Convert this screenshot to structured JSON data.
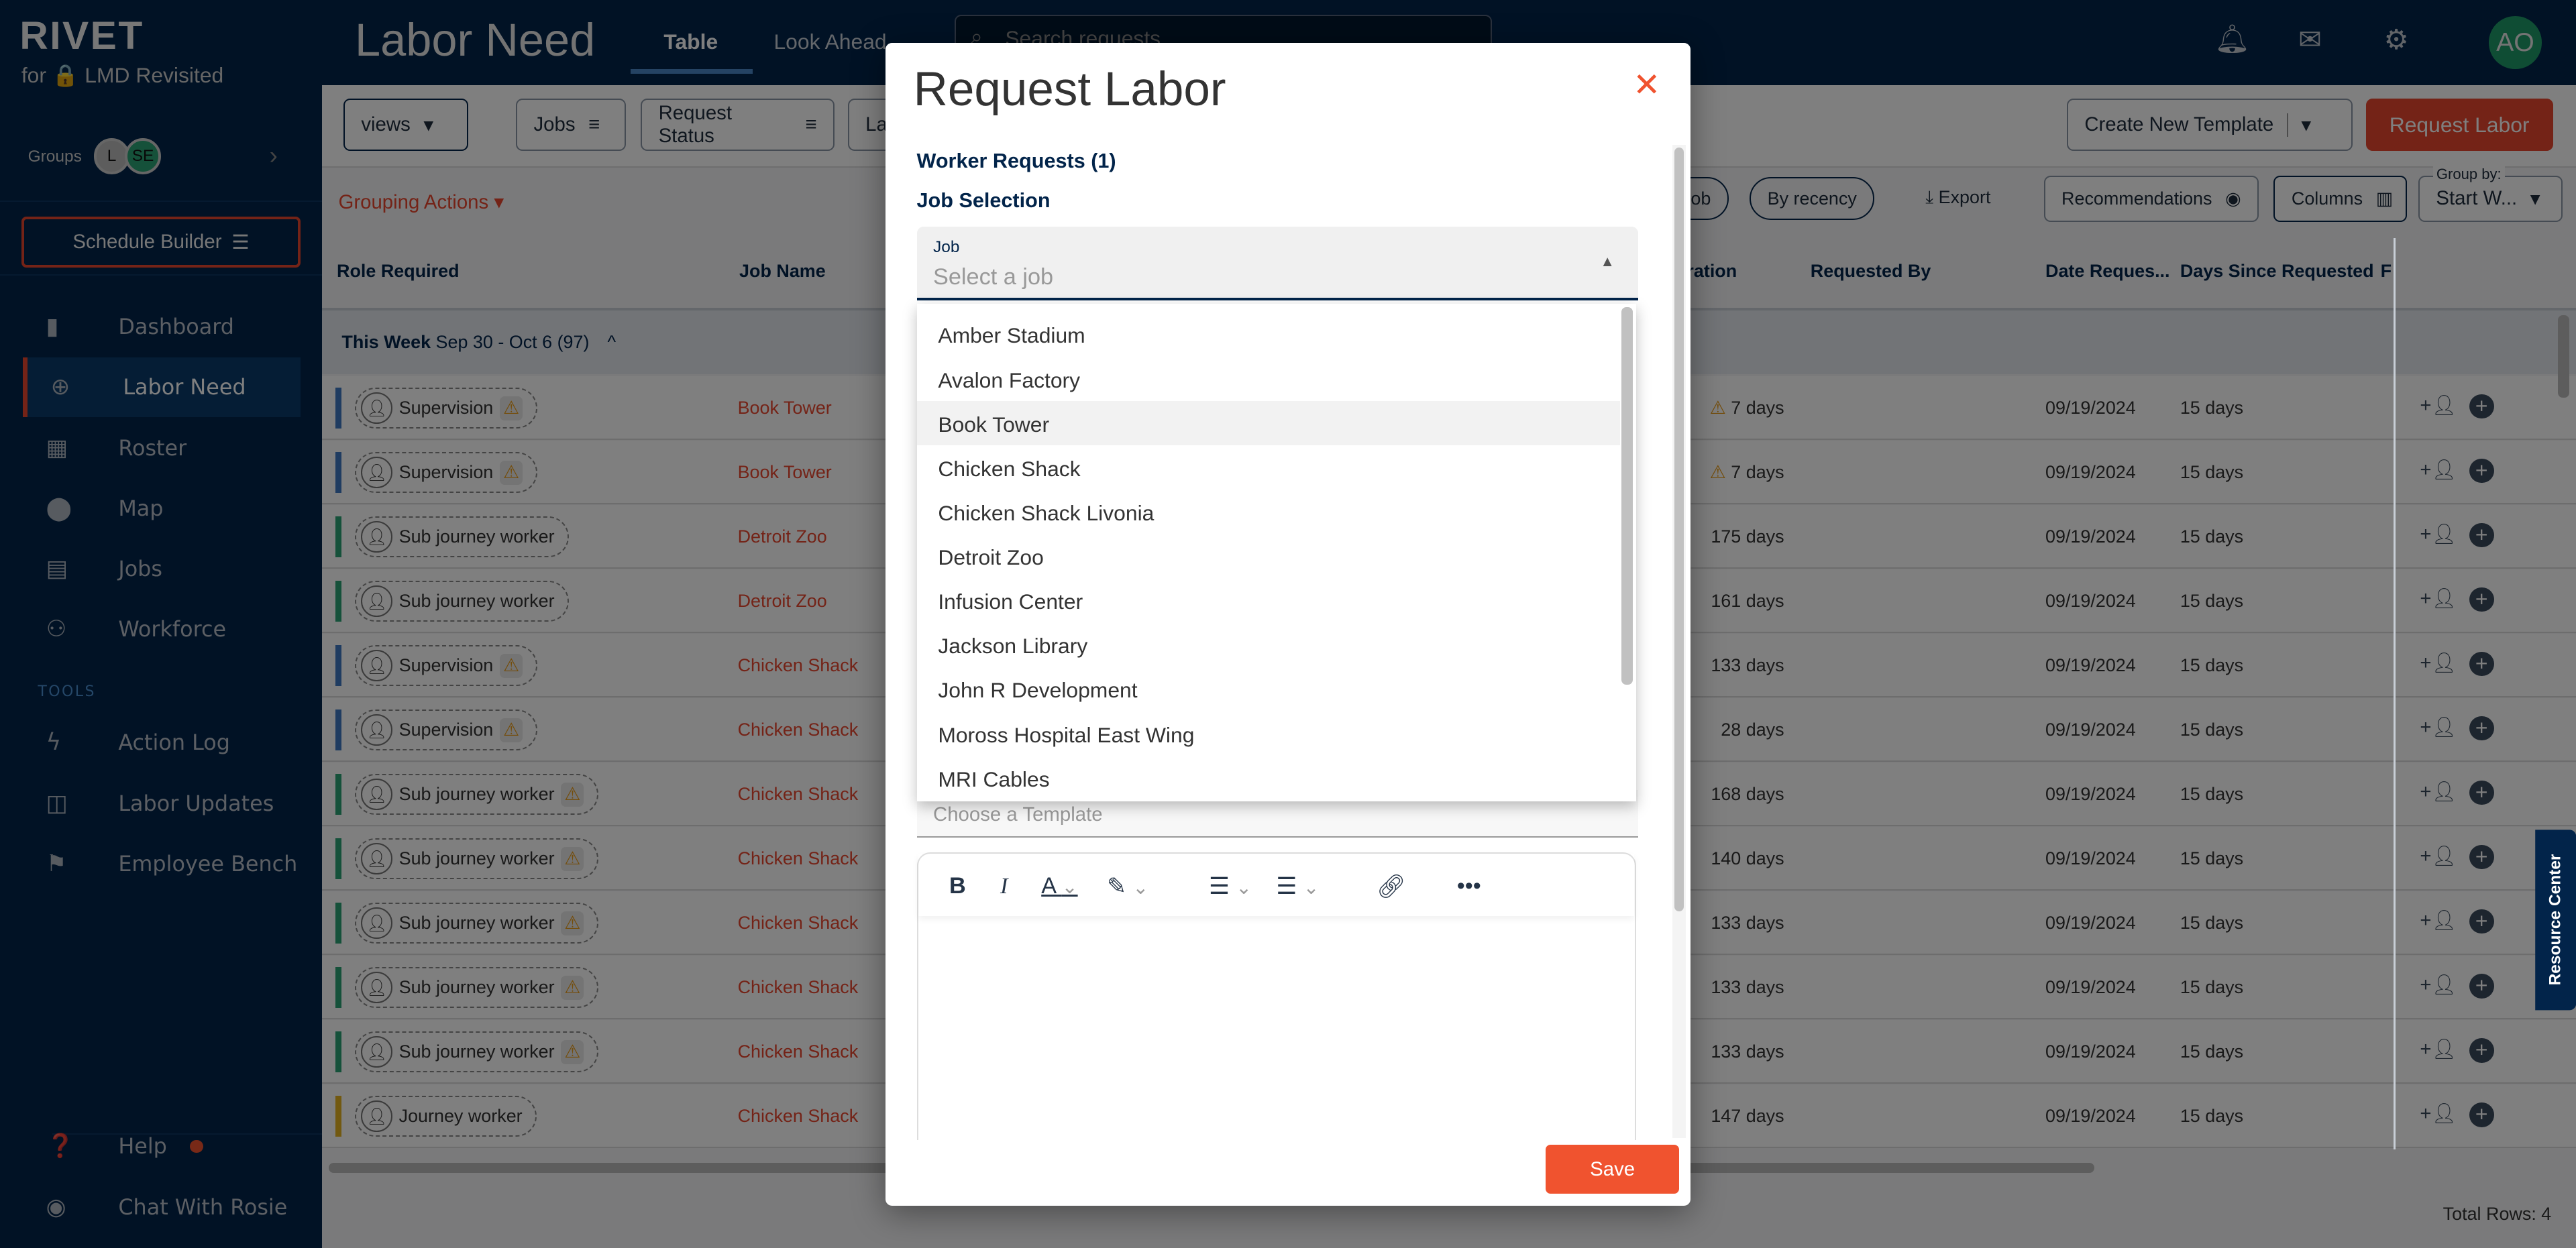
{
  "sidebar": {
    "logo": "RIVET",
    "subtitle": "for 🔒 LMD Revisited",
    "groups_label": "Groups",
    "group_avatars": [
      "L",
      "SE"
    ],
    "schedule_builder": "Schedule Builder",
    "nav": [
      {
        "label": "Dashboard",
        "icon": "bar-chart-icon"
      },
      {
        "label": "Labor Need",
        "icon": "person-add-icon",
        "active": true
      },
      {
        "label": "Roster",
        "icon": "table-icon"
      },
      {
        "label": "Map",
        "icon": "map-pin-icon"
      },
      {
        "label": "Jobs",
        "icon": "building-icon"
      },
      {
        "label": "Workforce",
        "icon": "people-icon"
      }
    ],
    "tools_label": "TOOLS",
    "tools": [
      {
        "label": "Action Log",
        "icon": "bolt-icon"
      },
      {
        "label": "Labor Updates",
        "icon": "broadcast-icon"
      },
      {
        "label": "Employee Bench",
        "icon": "flag-icon"
      }
    ],
    "help": "Help",
    "chat": "Chat With Rosie"
  },
  "header": {
    "title": "Labor Need",
    "tabs": [
      "Table",
      "Look Ahead"
    ],
    "search_placeholder": "Search requests",
    "avatar": "AO"
  },
  "toolbar": {
    "views": "views",
    "filters": [
      "Jobs",
      "Request Status",
      "La"
    ],
    "create_template": "Create New Template",
    "request_labor": "Request Labor",
    "grouping_actions": "Grouping Actions",
    "pill_by_job": "By job",
    "pill_by_recency": "By recency",
    "export": "Export",
    "recommendations": "Recommendations",
    "columns": "Columns",
    "group_by_label": "Group by:",
    "group_by_value": "Start W..."
  },
  "table": {
    "headers": [
      "Role Required",
      "Job Name",
      "uration",
      "Requested By",
      "Date Reques...",
      "Days Since Requested",
      "F"
    ],
    "group": {
      "label": "This Week",
      "range": "Sep 30 - Oct 6 (97)"
    },
    "colors": {
      "blue": "#3f78c2",
      "green": "#2aa275",
      "yellow": "#e5b320"
    },
    "rows": [
      {
        "role": "Supervision",
        "warn": true,
        "color": "blue",
        "job": "Book Tower",
        "duration": "7 days",
        "dwarn": true,
        "date": "09/19/2024",
        "since": "15 days"
      },
      {
        "role": "Supervision",
        "warn": true,
        "color": "blue",
        "job": "Book Tower",
        "duration": "7 days",
        "dwarn": true,
        "date": "09/19/2024",
        "since": "15 days"
      },
      {
        "role": "Sub journey worker",
        "warn": false,
        "color": "green",
        "job": "Detroit Zoo",
        "duration": "175 days",
        "date": "09/19/2024",
        "since": "15 days"
      },
      {
        "role": "Sub journey worker",
        "warn": false,
        "color": "green",
        "job": "Detroit Zoo",
        "duration": "161 days",
        "date": "09/19/2024",
        "since": "15 days"
      },
      {
        "role": "Supervision",
        "warn": true,
        "color": "blue",
        "job": "Chicken Shack",
        "duration": "133 days",
        "date": "09/19/2024",
        "since": "15 days"
      },
      {
        "role": "Supervision",
        "warn": true,
        "color": "blue",
        "job": "Chicken Shack",
        "duration": "28 days",
        "date": "09/19/2024",
        "since": "15 days"
      },
      {
        "role": "Sub journey worker",
        "warn": true,
        "color": "green",
        "job": "Chicken Shack",
        "duration": "168 days",
        "date": "09/19/2024",
        "since": "15 days"
      },
      {
        "role": "Sub journey worker",
        "warn": true,
        "color": "green",
        "job": "Chicken Shack",
        "duration": "140 days",
        "date": "09/19/2024",
        "since": "15 days"
      },
      {
        "role": "Sub journey worker",
        "warn": true,
        "color": "green",
        "job": "Chicken Shack",
        "duration": "133 days",
        "date": "09/19/2024",
        "since": "15 days"
      },
      {
        "role": "Sub journey worker",
        "warn": true,
        "color": "green",
        "job": "Chicken Shack",
        "duration": "133 days",
        "date": "09/19/2024",
        "since": "15 days"
      },
      {
        "role": "Sub journey worker",
        "warn": true,
        "color": "green",
        "job": "Chicken Shack",
        "duration": "133 days",
        "date": "09/19/2024",
        "since": "15 days"
      },
      {
        "role": "Journey worker",
        "warn": false,
        "color": "yellow",
        "job": "Chicken Shack",
        "duration": "147 days",
        "date": "09/19/2024",
        "since": "15 days"
      }
    ],
    "total_rows": "Total Rows: 4"
  },
  "resource_center": "Resource Center",
  "modal": {
    "title": "Request Labor",
    "worker_requests": "Worker Requests (1)",
    "job_selection": "Job Selection",
    "job_label": "Job",
    "job_placeholder": "Select a job",
    "job_options": [
      "Amber Stadium",
      "Avalon Factory",
      "Book Tower",
      "Chicken Shack",
      "Chicken Shack Livonia",
      "Detroit Zoo",
      "Infusion Center",
      "Jackson Library",
      "John R Development",
      "Moross Hospital East Wing",
      "MRI Cables"
    ],
    "highlighted_option": "Book Tower",
    "template_placeholder": "Choose a Template",
    "save": "Save"
  }
}
